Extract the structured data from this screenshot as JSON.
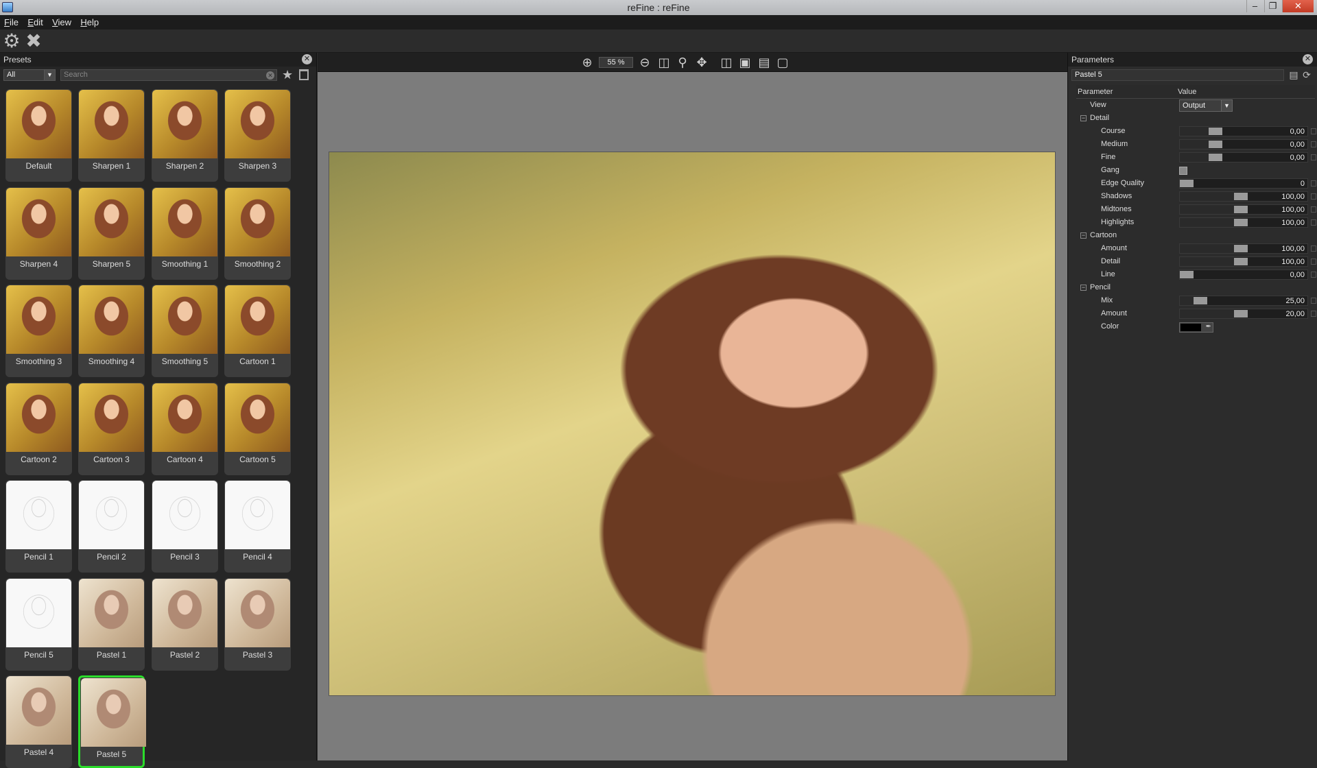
{
  "window": {
    "title": "reFine : reFine"
  },
  "menu": [
    "File",
    "Edit",
    "View",
    "Help"
  ],
  "presets_panel": {
    "title": "Presets",
    "filter_value": "All",
    "search_placeholder": "Search",
    "items": [
      {
        "label": "Default",
        "style": "color"
      },
      {
        "label": "Sharpen 1",
        "style": "color"
      },
      {
        "label": "Sharpen 2",
        "style": "color"
      },
      {
        "label": "Sharpen 3",
        "style": "color"
      },
      {
        "label": "Sharpen 4",
        "style": "color"
      },
      {
        "label": "Sharpen 5",
        "style": "color"
      },
      {
        "label": "Smoothing 1",
        "style": "color"
      },
      {
        "label": "Smoothing 2",
        "style": "color"
      },
      {
        "label": "Smoothing 3",
        "style": "color"
      },
      {
        "label": "Smoothing 4",
        "style": "color"
      },
      {
        "label": "Smoothing 5",
        "style": "color"
      },
      {
        "label": "Cartoon 1",
        "style": "color"
      },
      {
        "label": "Cartoon 2",
        "style": "color"
      },
      {
        "label": "Cartoon 3",
        "style": "color"
      },
      {
        "label": "Cartoon 4",
        "style": "color"
      },
      {
        "label": "Cartoon 5",
        "style": "color"
      },
      {
        "label": "Pencil 1",
        "style": "pencil"
      },
      {
        "label": "Pencil 2",
        "style": "pencil"
      },
      {
        "label": "Pencil 3",
        "style": "pencil"
      },
      {
        "label": "Pencil 4",
        "style": "pencil"
      },
      {
        "label": "Pencil 5",
        "style": "pencil"
      },
      {
        "label": "Pastel 1",
        "style": "pastel"
      },
      {
        "label": "Pastel 2",
        "style": "pastel"
      },
      {
        "label": "Pastel 3",
        "style": "pastel"
      },
      {
        "label": "Pastel 4",
        "style": "pastel"
      },
      {
        "label": "Pastel 5",
        "style": "pastel",
        "selected": true
      }
    ]
  },
  "viewer": {
    "zoom": "55 %"
  },
  "parameters_panel": {
    "title": "Parameters",
    "preset_name": "Pastel 5",
    "col_parameter": "Parameter",
    "col_value": "Value",
    "view_label": "View",
    "view_value": "Output",
    "groups": [
      {
        "name": "Detail",
        "rows": [
          {
            "name": "Course",
            "type": "slider",
            "value": "0,00",
            "fraction": 0.25
          },
          {
            "name": "Medium",
            "type": "slider",
            "value": "0,00",
            "fraction": 0.25
          },
          {
            "name": "Fine",
            "type": "slider",
            "value": "0,00",
            "fraction": 0.25
          },
          {
            "name": "Gang",
            "type": "check"
          },
          {
            "name": "Edge Quality",
            "type": "slider",
            "value": "0",
            "fraction": 0.0
          },
          {
            "name": "Shadows",
            "type": "slider",
            "value": "100,00",
            "fraction": 0.47
          },
          {
            "name": "Midtones",
            "type": "slider",
            "value": "100,00",
            "fraction": 0.47
          },
          {
            "name": "Highlights",
            "type": "slider",
            "value": "100,00",
            "fraction": 0.47
          }
        ]
      },
      {
        "name": "Cartoon",
        "rows": [
          {
            "name": "Amount",
            "type": "slider",
            "value": "100,00",
            "fraction": 0.47
          },
          {
            "name": "Detail",
            "type": "slider",
            "value": "100,00",
            "fraction": 0.47
          },
          {
            "name": "Line",
            "type": "slider",
            "value": "0,00",
            "fraction": 0.0
          }
        ]
      },
      {
        "name": "Pencil",
        "rows": [
          {
            "name": "Mix",
            "type": "slider",
            "value": "25,00",
            "fraction": 0.12
          },
          {
            "name": "Amount",
            "type": "slider",
            "value": "20,00",
            "fraction": 0.47
          },
          {
            "name": "Color",
            "type": "color",
            "color": "#000000"
          }
        ]
      }
    ]
  }
}
